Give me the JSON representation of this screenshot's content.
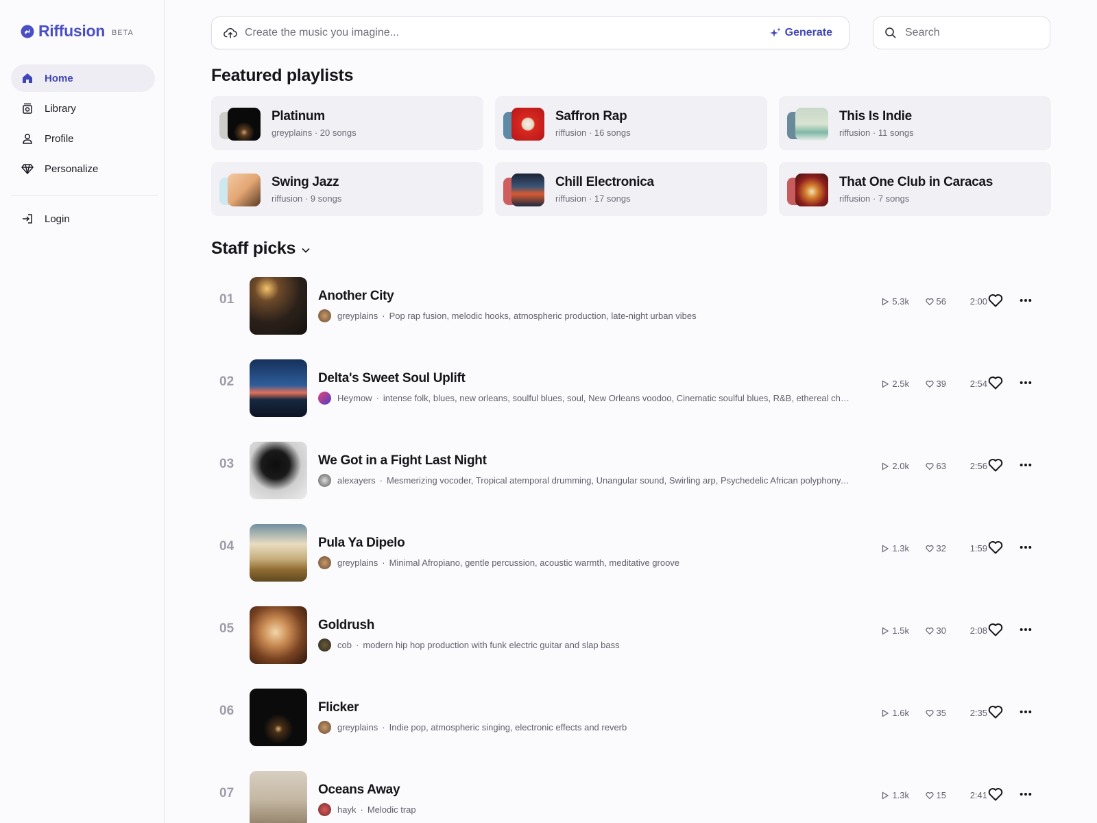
{
  "brand": {
    "name": "Riffusion",
    "badge": "BETA",
    "accent": "#4a4fc4"
  },
  "sidebar": {
    "items": [
      {
        "label": "Home",
        "icon": "home-icon",
        "active": true
      },
      {
        "label": "Library",
        "icon": "library-icon"
      },
      {
        "label": "Profile",
        "icon": "profile-icon"
      },
      {
        "label": "Personalize",
        "icon": "diamond-icon"
      }
    ],
    "login": {
      "label": "Login",
      "icon": "login-icon"
    }
  },
  "prompt": {
    "placeholder": "Create the music you imagine...",
    "generate_label": "Generate"
  },
  "search": {
    "placeholder": "Search"
  },
  "featured": {
    "title": "Featured playlists",
    "playlists": [
      {
        "name": "Platinum",
        "meta": "greyplains · 20 songs"
      },
      {
        "name": "Saffron Rap",
        "meta": "riffusion · 16 songs"
      },
      {
        "name": "This Is Indie",
        "meta": "riffusion · 11 songs"
      },
      {
        "name": "Swing Jazz",
        "meta": "riffusion · 9 songs"
      },
      {
        "name": "Chill Electronica",
        "meta": "riffusion · 17 songs"
      },
      {
        "name": "That One Club in Caracas",
        "meta": "riffusion · 7 songs"
      }
    ]
  },
  "staff": {
    "title": "Staff picks",
    "tracks": [
      {
        "num": "01",
        "title": "Another City",
        "artist": "greyplains",
        "tags": "Pop rap fusion, melodic hooks, atmospheric production, late-night urban vibes",
        "plays": "5.3k",
        "likes": "56",
        "duration": "2:00"
      },
      {
        "num": "02",
        "title": "Delta's Sweet Soul Uplift",
        "artist": "Heymow",
        "tags": "intense folk, blues, new orleans, soulful blues, soul, New Orleans voodoo, Cinematic soulful blues, R&B, ethereal chants, r...",
        "plays": "2.5k",
        "likes": "39",
        "duration": "2:54"
      },
      {
        "num": "03",
        "title": "We Got in a Fight Last Night",
        "artist": "alexayers",
        "tags": "Mesmerizing vocoder, Tropical atemporal drumming, Unangular sound, Swirling arp, Psychedelic African polyphony, , Ex...",
        "plays": "2.0k",
        "likes": "63",
        "duration": "2:56"
      },
      {
        "num": "04",
        "title": "Pula Ya Dipelo",
        "artist": "greyplains",
        "tags": "Minimal Afropiano, gentle percussion, acoustic warmth, meditative groove",
        "plays": "1.3k",
        "likes": "32",
        "duration": "1:59"
      },
      {
        "num": "05",
        "title": "Goldrush",
        "artist": "cob",
        "tags": "modern hip hop production with funk electric guitar and slap bass",
        "plays": "1.5k",
        "likes": "30",
        "duration": "2:08"
      },
      {
        "num": "06",
        "title": "Flicker",
        "artist": "greyplains",
        "tags": "Indie pop, atmospheric singing, electronic effects and reverb",
        "plays": "1.6k",
        "likes": "35",
        "duration": "2:35"
      },
      {
        "num": "07",
        "title": "Oceans Away",
        "artist": "hayk",
        "tags": "Melodic trap",
        "plays": "1.3k",
        "likes": "15",
        "duration": "2:41"
      }
    ]
  }
}
